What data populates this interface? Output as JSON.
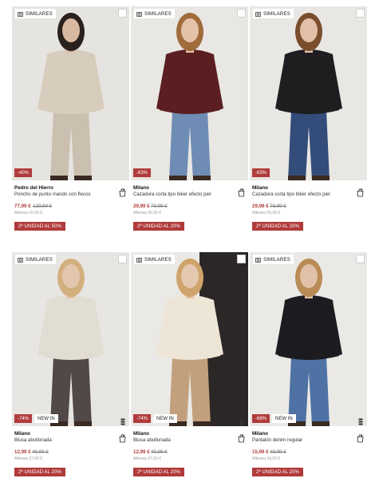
{
  "products": [
    {
      "similares_label": "SIMILARES",
      "discount": "-40%",
      "new_in": "",
      "brand": "Pedro del Hierro",
      "name": "Poncho de punto mando con flecos",
      "price": "77,99 €",
      "old_price": "129,99 €",
      "afterwards": "Afterwa 10,99 €",
      "promo": "2ª UNIDAD AL 50%",
      "colors": {
        "bg": "#e6e4e1",
        "garment": "#d8cdbd",
        "pants": "#cbbfb0",
        "skin": "#d9b9a1",
        "hair": "#2a211c"
      }
    },
    {
      "similares_label": "SIMILARES",
      "discount": "-63%",
      "new_in": "",
      "brand": "Milano",
      "name": "Cazadora corta tipo biker efecto piel",
      "price": "29,99 €",
      "old_price": "79,99 €",
      "afterwards": "Afterwa 50,99 €",
      "promo": "2ª UNIDAD AL 20%",
      "colors": {
        "bg": "#e9e7e4",
        "garment": "#5b1f22",
        "pants": "#6f8db4",
        "skin": "#e3c2a8",
        "hair": "#a06c3c"
      }
    },
    {
      "similares_label": "SIMILARES",
      "discount": "-63%",
      "new_in": "",
      "brand": "Milano",
      "name": "Cazadora corta tipo biker efecto piel",
      "price": "29,99 €",
      "old_price": "79,99 €",
      "afterwards": "Afterwa 50,99 €",
      "promo": "2ª UNIDAD AL 20%",
      "colors": {
        "bg": "#e9e7e4",
        "garment": "#1f1d1f",
        "pants": "#334c7a",
        "skin": "#e1c0a7",
        "hair": "#7a4d2d"
      }
    },
    {
      "similares_label": "SIMILARES",
      "discount": "-74%",
      "new_in": "NEW IN",
      "brand": "Milano",
      "name": "Blusa abullonada",
      "price": "12,99 €",
      "old_price": "49,99 €",
      "afterwards": "Afterwa 37,00 €",
      "promo": "2ª UNIDAD AL 20%",
      "colors": {
        "bg": "#e8e6e3",
        "garment": "#e2ddd2",
        "pants": "#514848",
        "skin": "#e3c6ae",
        "hair": "#d2b07e"
      }
    },
    {
      "similares_label": "SIMILARES",
      "discount": "-74%",
      "new_in": "NEW IN",
      "brand": "Milano",
      "name": "Blusa abullonada",
      "price": "12,99 €",
      "old_price": "49,99 €",
      "afterwards": "Afterwa 37,00 €",
      "promo": "2ª UNIDAD AL 20%",
      "colors": {
        "bg": "#ebe9e6",
        "garment": "#ede5d6",
        "pants": "#c2a07d",
        "skin": "#e5c8b0",
        "hair": "#cfa46c"
      }
    },
    {
      "similares_label": "SIMILARES",
      "discount": "-68%",
      "new_in": "NEW IN",
      "brand": "Milano",
      "name": "Pantalón denim regular",
      "price": "15,99 €",
      "old_price": "49,99 €",
      "afterwards": "Afterwa 34,00 €",
      "promo": "2ª UNIDAD AL 20%",
      "colors": {
        "bg": "#ebe9e6",
        "garment": "#1c1b1f",
        "pants": "#4f72a4",
        "skin": "#e0c1a7",
        "hair": "#b98b55"
      }
    }
  ],
  "icons": {
    "similares": "camera-search-icon",
    "select": "checkbox-icon",
    "cart": "shopping-bag-add-icon",
    "side": "size-stack-icon"
  }
}
